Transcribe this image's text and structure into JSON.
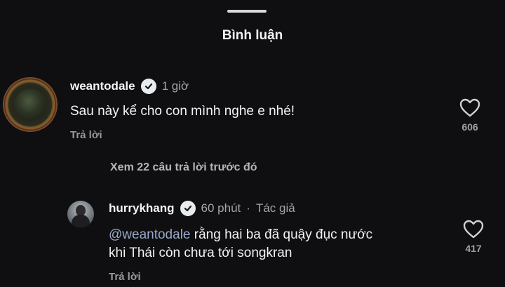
{
  "header": {
    "title": "Bình luận"
  },
  "comments": [
    {
      "username": "weantodale",
      "time": "1 giờ",
      "text": "Sau này kể cho con mình nghe e nhé!",
      "reply_label": "Trả lời",
      "like_count": "606",
      "view_replies": "Xem 22 câu trả lời trước đó"
    },
    {
      "username": "hurrykhang",
      "time": "60 phút",
      "separator": "·",
      "author_tag": "Tác giả",
      "mention": "@weantodale",
      "text_line1": " rằng hai ba đã quậy đục nước",
      "text_line2": "khi Thái còn chưa tới songkran",
      "reply_label": "Trả lời",
      "like_count": "417"
    }
  ],
  "icons": {
    "verified": "verified-badge-icon",
    "like": "heart-outline-icon"
  },
  "colors": {
    "background": "#0f0f11",
    "mention": "#9aa9c9",
    "secondary_text": "#a6a6a6"
  }
}
